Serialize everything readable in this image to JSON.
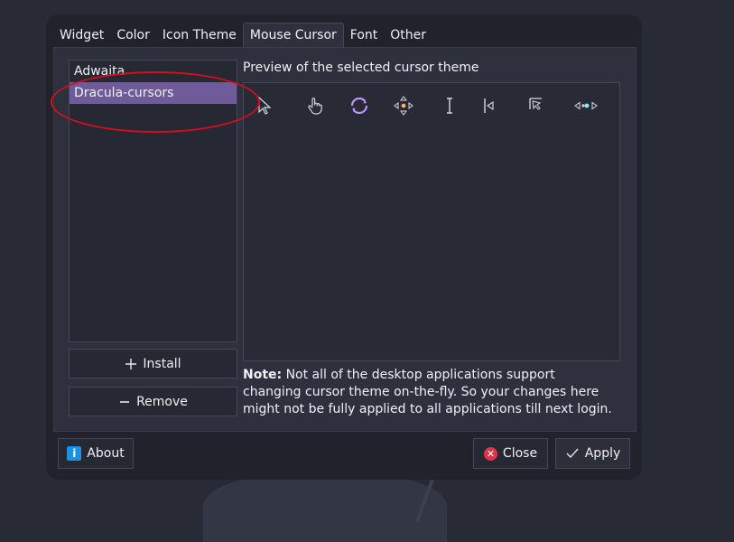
{
  "tabs": [
    "Widget",
    "Color",
    "Icon Theme",
    "Mouse Cursor",
    "Font",
    "Other"
  ],
  "active_tab": "Mouse Cursor",
  "themes": [
    {
      "label": "Adwaita",
      "selected": false
    },
    {
      "label": "Dracula-cursors",
      "selected": true
    }
  ],
  "buttons": {
    "install": "Install",
    "remove": "Remove",
    "about": "About",
    "close": "Close",
    "apply": "Apply"
  },
  "preview": {
    "title": "Preview of the selected cursor theme",
    "cursors": [
      "arrow-pointer-icon",
      "hand-pointer-icon",
      "busy-spinner-icon",
      "move-cursor-icon",
      "text-ibeam-icon",
      "resize-left-icon",
      "resize-corner-icon",
      "resize-horizontal-icon"
    ]
  },
  "note": {
    "label": "Note:",
    "text": " Not all of the desktop applications support changing cursor theme on-the-fly. So your changes here might not be fully applied to all applications till next login."
  },
  "colors": {
    "selection": "#6f5b9a",
    "accent": "#bd93f9",
    "annotation": "#d0101c"
  }
}
